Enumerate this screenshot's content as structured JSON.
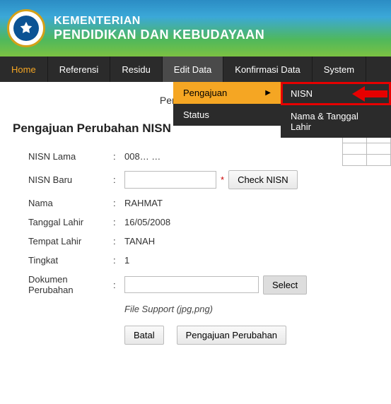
{
  "header": {
    "line1": "KEMENTERIAN",
    "line2": "PENDIDIKAN DAN KEBUDAYAAN"
  },
  "nav": {
    "home": "Home",
    "referensi": "Referensi",
    "residu": "Residu",
    "edit_data": "Edit Data",
    "konfirmasi": "Konfirmasi Data",
    "system": "System"
  },
  "dropdown": {
    "pengajuan": "Pengajuan",
    "status": "Status"
  },
  "submenu": {
    "nisn": "NISN",
    "nama_tgl": "Nama & Tanggal Lahir"
  },
  "page": {
    "subtitle_prefix": "Perbandingan D",
    "section_title": "Pengajuan Perubahan NISN"
  },
  "form": {
    "labels": {
      "nisn_lama": "NISN Lama",
      "nisn_baru": "NISN Baru",
      "nama": "Nama",
      "tgl_lahir": "Tanggal Lahir",
      "tempat_lahir": "Tempat Lahir",
      "tingkat": "Tingkat",
      "dokumen": "Dokumen Perubahan"
    },
    "values": {
      "nisn_lama": "008…  …",
      "nisn_baru": "",
      "nama": "RAHMAT",
      "tgl_lahir": "16/05/2008",
      "tempat_lahir": "TANAH",
      "tingkat": "1"
    },
    "check_btn": "Check NISN",
    "select_btn": "Select",
    "file_hint": "File Support (jpg,png)",
    "batal_btn": "Batal",
    "submit_btn": "Pengajuan Perubahan",
    "colon": ":"
  }
}
